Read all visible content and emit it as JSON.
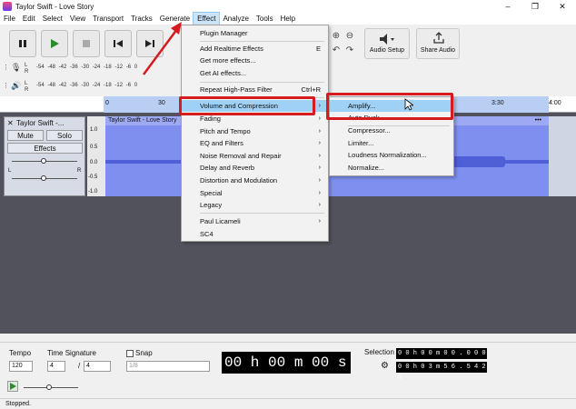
{
  "window": {
    "title": "Taylor Swift - Love Story"
  },
  "menubar": [
    "File",
    "Edit",
    "Select",
    "View",
    "Transport",
    "Tracks",
    "Generate",
    "Effect",
    "Analyze",
    "Tools",
    "Help"
  ],
  "toolbar": {
    "audio_setup": "Audio Setup",
    "share_audio": "Share Audio"
  },
  "meters": {
    "rec_channels": [
      "L",
      "R"
    ],
    "rec_scale": "-54 -48 -42 -36 -30 -24 -18 -12 -6 0",
    "play_channels": [
      "L",
      "R"
    ],
    "play_scale": "-54 -48 -42 -36 -30 -24 -18 -12 -6 0"
  },
  "ruler": {
    "ticks": [
      "0",
      "30",
      "3:30",
      "4:00"
    ]
  },
  "track": {
    "name": "Taylor Swift -...",
    "mute": "Mute",
    "solo": "Solo",
    "effects": "Effects",
    "pan_left": "L",
    "pan_right": "R",
    "scale": [
      "1.0",
      "0.5",
      "0.0",
      "-0.5",
      "-1.0"
    ],
    "clip_name": "Taylor Swift - Love Story"
  },
  "effect_menu": {
    "items": [
      "Plugin Manager",
      "Add Realtime Effects",
      "Get more effects...",
      "Get AI effects...",
      "Repeat High-Pass Filter",
      "Volume and Compression",
      "Fading",
      "Pitch and Tempo",
      "EQ and Filters",
      "Noise Removal and Repair",
      "Delay and Reverb",
      "Distortion and Modulation",
      "Special",
      "Legacy",
      "Paul Licameli",
      "SC4"
    ],
    "shortcut_realtime": "E",
    "shortcut_repeat": "Ctrl+R"
  },
  "submenu": {
    "items": [
      "Amplify...",
      "Auto Duck...",
      "Compressor...",
      "Limiter...",
      "Loudness Normalization...",
      "Normalize..."
    ]
  },
  "bottom": {
    "tempo_label": "Tempo",
    "tempo_value": "120",
    "timesig_label": "Time Signature",
    "timesig_num": "4",
    "timesig_sep": "/",
    "timesig_den": "4",
    "snap_label": "Snap",
    "snap_value": "1/8",
    "time_display": "00 h 00 m 00 s",
    "selection_label": "Selection",
    "sel_start": "0 0 h 0 0 m 0 0 . 0 0 0 s",
    "sel_end": "0 0 h 0 3 m 5 6 . 5 4 2 s"
  },
  "status": "Stopped.",
  "colors": {
    "highlight": "#9fd0f5",
    "annotation": "#d61b1f",
    "clip": "#7f8ff0"
  }
}
